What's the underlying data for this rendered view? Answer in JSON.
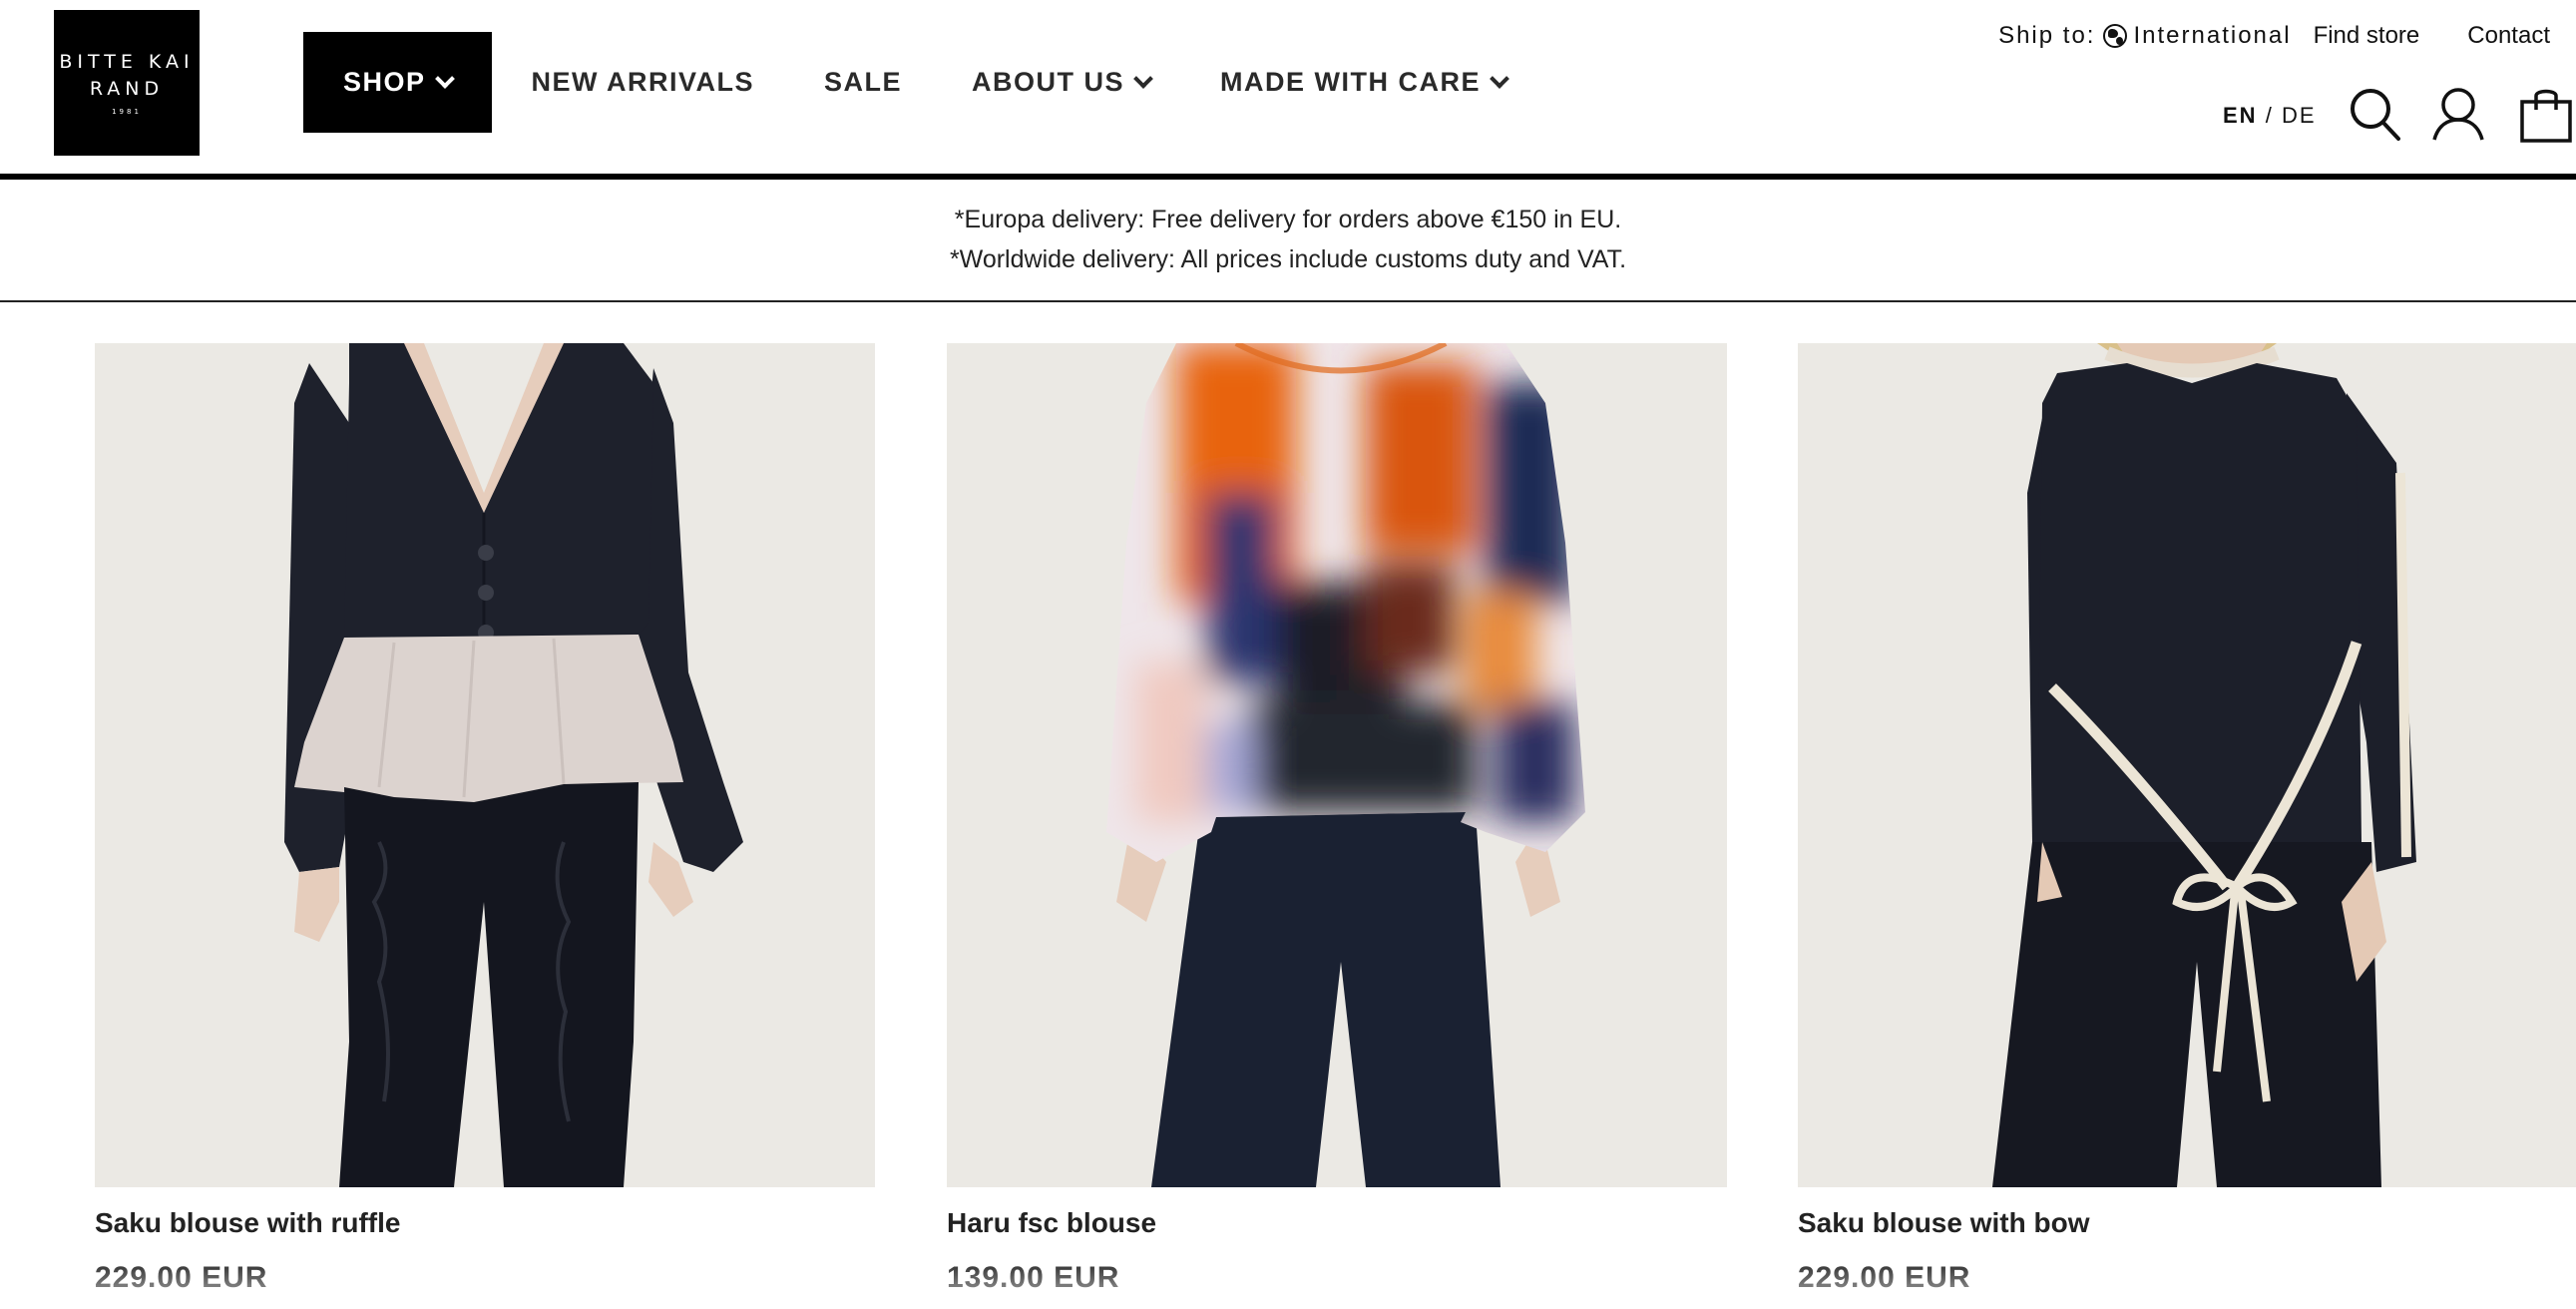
{
  "brand": {
    "line1": "BITTE KAI",
    "line2": "RAND",
    "year": "1981"
  },
  "nav": [
    {
      "label": "SHOP"
    },
    {
      "label": "NEW ARRIVALS"
    },
    {
      "label": "SALE"
    },
    {
      "label": "ABOUT US"
    },
    {
      "label": "MADE WITH CARE"
    }
  ],
  "utility": {
    "ship_label": "Ship to:",
    "ship_value": "International",
    "find_store": "Find store",
    "contact": "Contact"
  },
  "language": {
    "current": "EN",
    "separator": "/",
    "other": "DE"
  },
  "icons": {
    "search": "search-icon",
    "account": "account-icon",
    "cart": "shopping-bag-icon"
  },
  "banner": {
    "line1": "*Europa delivery: Free delivery for orders above €150 in EU.",
    "line2": "*Worldwide delivery: All prices include customs duty and VAT."
  },
  "products": [
    {
      "name": "Saku blouse with ruffle",
      "price": "229.00 EUR"
    },
    {
      "name": "Haru fsc blouse",
      "price": "139.00 EUR"
    },
    {
      "name": "Saku blouse with bow",
      "price": "229.00 EUR"
    }
  ],
  "colors": {
    "ink": "#000000",
    "photo_bg": "#ebe9e4",
    "navy": "#1b1f2b"
  }
}
